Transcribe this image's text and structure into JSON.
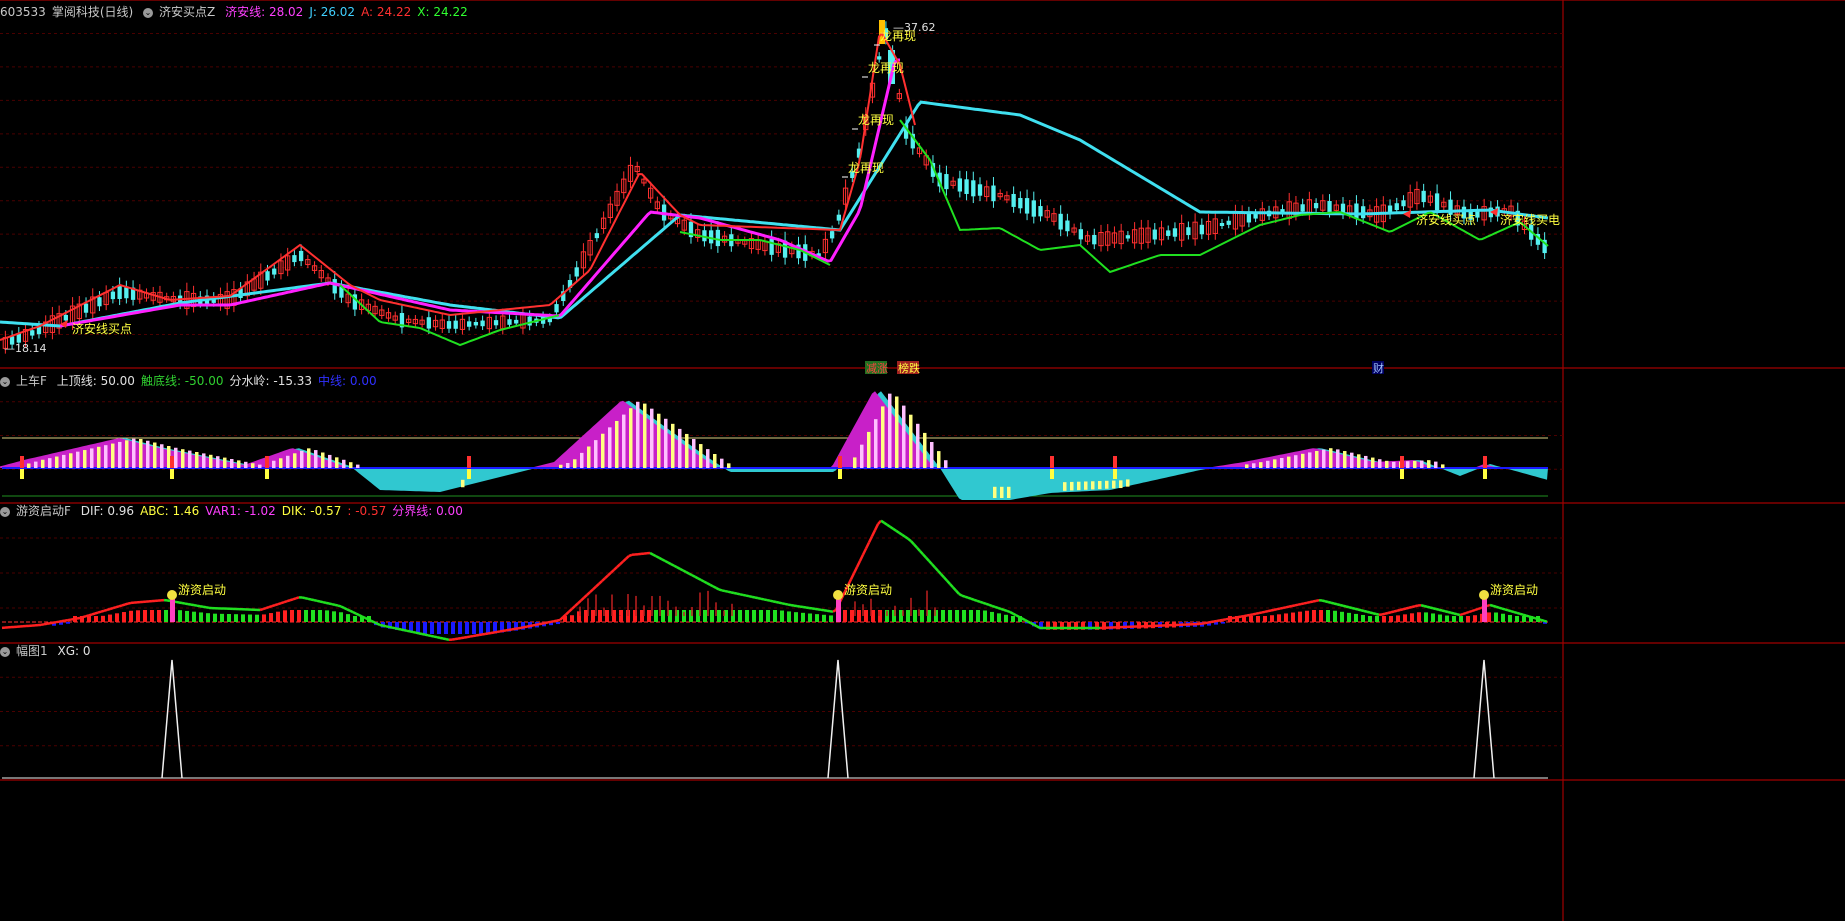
{
  "colors": {
    "bg": "#000000",
    "grid": "#4a0000",
    "border": "#a00000",
    "up": "#ff3030",
    "down": "#55f0f0",
    "cyan": "#40e0f0",
    "magenta": "#ff20ff",
    "green": "#20e020",
    "yellow": "#ffff40",
    "white": "#ffffff",
    "blue": "#1a1aff"
  },
  "header1": {
    "code": "603533",
    "name": "掌阅科技",
    "period": "(日线)",
    "indicator": "济安买点Z",
    "items": [
      {
        "label": "济安线: 28.02",
        "color": "#ff40ff"
      },
      {
        "label": "J: 26.02",
        "color": "#40d0ff"
      },
      {
        "label": "A: 24.22",
        "color": "#ff3030"
      },
      {
        "label": "X: 24.22",
        "color": "#30ff30"
      }
    ]
  },
  "header2": {
    "indicator": "上车F",
    "items": [
      {
        "label": "上顶线: 50.00",
        "color": "#e0e0e0"
      },
      {
        "label": "触底线: -50.00",
        "color": "#30d030"
      },
      {
        "label": "分水岭: -15.33",
        "color": "#e0e0e0"
      },
      {
        "label": "中线: 0.00",
        "color": "#3030ff"
      }
    ]
  },
  "header3": {
    "indicator": "游资启动F",
    "items": [
      {
        "label": "DIF: 0.96",
        "color": "#e0e0e0"
      },
      {
        "label": "ABC: 1.46",
        "color": "#ffff40"
      },
      {
        "label": "VAR1: -1.02",
        "color": "#ff40ff"
      },
      {
        "label": "DIK: -0.57",
        "color": "#ffff40"
      },
      {
        "label": ": -0.57",
        "color": "#ff3030"
      },
      {
        "label": "分界线: 0.00",
        "color": "#ff40ff"
      }
    ]
  },
  "header4": {
    "indicator": "幅图1",
    "items": [
      {
        "label": "XG: 0",
        "color": "#e0e0e0"
      }
    ]
  },
  "annotations": {
    "high_price": "37.62",
    "low_price": "18.14",
    "dragon": "龙再现",
    "jian_buy": "济安线买点",
    "jian_buy_short": "济安线买电",
    "youzi": "游资启动",
    "markers": [
      {
        "text": "减涨",
        "bg": "#207020",
        "color": "#ff4040"
      },
      {
        "text": "榜跌",
        "bg": "#a02020",
        "color": "#ffff40"
      },
      {
        "text": "财",
        "bg": "#000060",
        "color": "#a0c0ff"
      }
    ]
  },
  "chart_data": [
    {
      "type": "candlestick",
      "title": "济安买点Z",
      "x": [
        1,
        2,
        3,
        4,
        5,
        6,
        7,
        8,
        9,
        10,
        11,
        12,
        13,
        14,
        15,
        16,
        17,
        18,
        19,
        20,
        21,
        22,
        23,
        24,
        25,
        26,
        27,
        28,
        29,
        30,
        31,
        32,
        33,
        34,
        35,
        36,
        37,
        38,
        39,
        40,
        41,
        42,
        43,
        44,
        45,
        46,
        47,
        48,
        49,
        50,
        51,
        52,
        53,
        54,
        55,
        56,
        57,
        58,
        59,
        60,
        61,
        62,
        63,
        64,
        65,
        66,
        67,
        68,
        69,
        70,
        71,
        72,
        73,
        74,
        75,
        76,
        77,
        78,
        79,
        80,
        81,
        82,
        83,
        84,
        85,
        86,
        87,
        88,
        89,
        90,
        91,
        92,
        93,
        94,
        95,
        96,
        97,
        98,
        99,
        100,
        101,
        102,
        103,
        104,
        105,
        106,
        107,
        108,
        109,
        110,
        111,
        112,
        113,
        114,
        115,
        116,
        117,
        118,
        119,
        120,
        121,
        122,
        123,
        124,
        125,
        126,
        127,
        128,
        129,
        130,
        131,
        132,
        133,
        134,
        135,
        136,
        137,
        138,
        139,
        140,
        141,
        142,
        143,
        144,
        145,
        146,
        147,
        148,
        149,
        150,
        151,
        152,
        153,
        154,
        155,
        156,
        157,
        158,
        159,
        160,
        161,
        162,
        163,
        164,
        165,
        166,
        167,
        168,
        169,
        170,
        171,
        172,
        173,
        174,
        175,
        176,
        177,
        178,
        179,
        180,
        181,
        182,
        183,
        184,
        185,
        186,
        187,
        188,
        189,
        190,
        191,
        192,
        193,
        194,
        195,
        196,
        197,
        198,
        199,
        200,
        201,
        202,
        203,
        204,
        205,
        206,
        207,
        208,
        209,
        210,
        211,
        212,
        213,
        214,
        215,
        216,
        217,
        218,
        219,
        220,
        221,
        222,
        223,
        224,
        225,
        226,
        227,
        228,
        229,
        230
      ],
      "close": [
        18.5,
        18.73,
        18.96,
        19.19,
        19.42,
        19.65,
        19.88,
        20.1,
        20.32,
        20.46,
        20.6,
        20.74,
        20.88,
        21.02,
        21.16,
        21.22,
        21.28,
        21.34,
        21.4,
        21.46,
        21.52,
        21.58,
        21.64,
        21.7,
        21.76,
        21.82,
        21.88,
        21.94,
        22.0,
        22.36,
        22.72,
        23.08,
        23.44,
        23.8,
        23.62,
        23.44,
        23.26,
        23.08,
        22.9,
        22.72,
        22.54,
        22.36,
        22.18,
        22.0,
        21.64,
        21.28,
        20.92,
        20.56,
        20.2,
        20.17,
        20.14,
        20.11,
        20.08,
        20.05,
        20.02,
        19.99,
        19.96,
        19.93,
        19.9,
        19.84,
        19.78,
        19.72,
        19.66,
        19.6,
        19.54,
        19.48,
        19.42,
        19.36,
        19.3,
        19.3,
        19.3,
        19.3,
        19.3,
        19.3,
        19.3,
        19.3,
        19.3,
        19.3,
        19.3,
        19.3,
        19.3,
        19.3,
        19.3,
        19.3,
        20.5,
        21.7,
        22.9,
        24.1,
        25.3,
        26.5,
        27.7,
        28.9,
        30.1,
        30.0,
        30.0,
        28.13,
        26.27,
        24.4,
        24.38,
        24.36,
        24.34,
        24.32,
        24.3,
        24.21,
        24.12,
        24.03,
        23.94,
        23.85,
        23.76,
        23.67,
        23.58,
        23.49,
        23.4,
        23.37,
        23.34,
        23.31,
        23.28,
        23.25,
        23.22,
        23.19,
        23.16,
        23.13,
        23.1,
        23.07,
        23.04,
        23.01,
        22.98,
        22.95,
        22.92,
        22.89,
        22.86,
        22.83,
        22.8,
        23.3,
        23.8,
        24.3,
        24.8,
        25.3,
        25.8,
        26.3,
        26.8,
        27.3,
        27.8,
        28.3,
        28.8,
        29.3,
        29.8,
        30.3,
        30.8,
        31.3,
        31.8,
        32.3,
        32.8,
        33.3,
        33.8,
        34.3,
        35.0,
        33.0,
        31.5,
        29.0,
        27.4,
        27.2,
        27.0,
        26.8,
        26.6,
        26.4,
        26.2,
        26.0,
        25.8,
        25.6,
        25.4,
        25.2,
        25.0,
        24.8,
        24.7,
        24.6,
        24.5,
        24.4,
        24.3,
        24.2,
        24.2,
        24.2,
        24.2,
        24.2,
        24.2,
        24.2,
        24.2,
        24.2,
        24.2,
        24.2,
        24.2,
        24.2,
        24.2,
        24.2,
        24.2,
        24.2,
        24.2,
        24.2,
        24.2,
        24.2,
        24.2,
        24.2,
        24.2,
        24.2,
        24.2,
        24.2,
        24.2,
        24.2,
        24.2,
        24.2,
        24.2,
        24.2,
        24.2,
        24.2,
        24.2,
        24.2,
        24.2,
        24.2,
        24.2,
        24.2,
        24.2,
        24.2,
        24.2,
        24.2,
        24.2,
        24.2,
        24.2,
        24.2,
        24.2,
        24.2,
        24.2,
        24.2
      ],
      "price_range": [
        17.5,
        38.5
      ],
      "high": 37.62,
      "low": 18.14
    }
  ]
}
